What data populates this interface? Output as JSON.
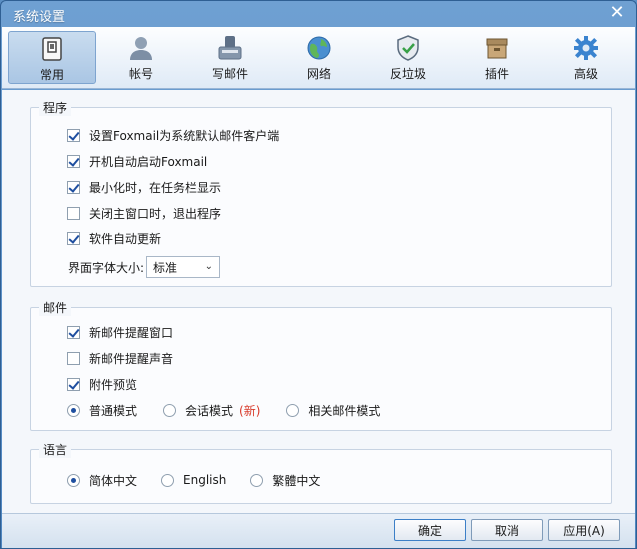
{
  "window": {
    "title": "系统设置",
    "close_glyph": "✕"
  },
  "toolbar": {
    "items": [
      {
        "label": "常用",
        "icon": "switch-icon",
        "active": true
      },
      {
        "label": "帐号",
        "icon": "user-icon"
      },
      {
        "label": "写邮件",
        "icon": "write-mail-icon"
      },
      {
        "label": "网络",
        "icon": "globe-icon"
      },
      {
        "label": "反垃圾",
        "icon": "shield-icon"
      },
      {
        "label": "插件",
        "icon": "plugin-box-icon"
      },
      {
        "label": "高级",
        "icon": "gear-icon"
      }
    ]
  },
  "program": {
    "title": "程序",
    "options": [
      {
        "label": "设置Foxmail为系统默认邮件客户端",
        "checked": true
      },
      {
        "label": "开机自动启动Foxmail",
        "checked": true
      },
      {
        "label": "最小化时，在任务栏显示",
        "checked": true
      },
      {
        "label": "关闭主窗口时，退出程序",
        "checked": false
      },
      {
        "label": "软件自动更新",
        "checked": true
      }
    ],
    "font_size_label": "界面字体大小:",
    "font_size_value": "标准"
  },
  "mail": {
    "title": "邮件",
    "options": [
      {
        "label": "新邮件提醒窗口",
        "checked": true
      },
      {
        "label": "新邮件提醒声音",
        "checked": false
      },
      {
        "label": "附件预览",
        "checked": true
      }
    ],
    "modes": [
      {
        "label": "普通模式",
        "checked": true
      },
      {
        "label": "会话模式",
        "tag": "(新)",
        "checked": false
      },
      {
        "label": "相关邮件模式",
        "checked": false
      }
    ]
  },
  "language": {
    "title": "语言",
    "options": [
      {
        "label": "简体中文",
        "checked": true
      },
      {
        "label": "English",
        "checked": false
      },
      {
        "label": "繁體中文",
        "checked": false
      }
    ]
  },
  "footer": {
    "ok": "确定",
    "cancel": "取消",
    "apply": "应用(A)"
  },
  "colors": {
    "title_bar": "#5b8fc4",
    "accent": "#1f4fa0",
    "new_tag": "#d83a2a"
  }
}
